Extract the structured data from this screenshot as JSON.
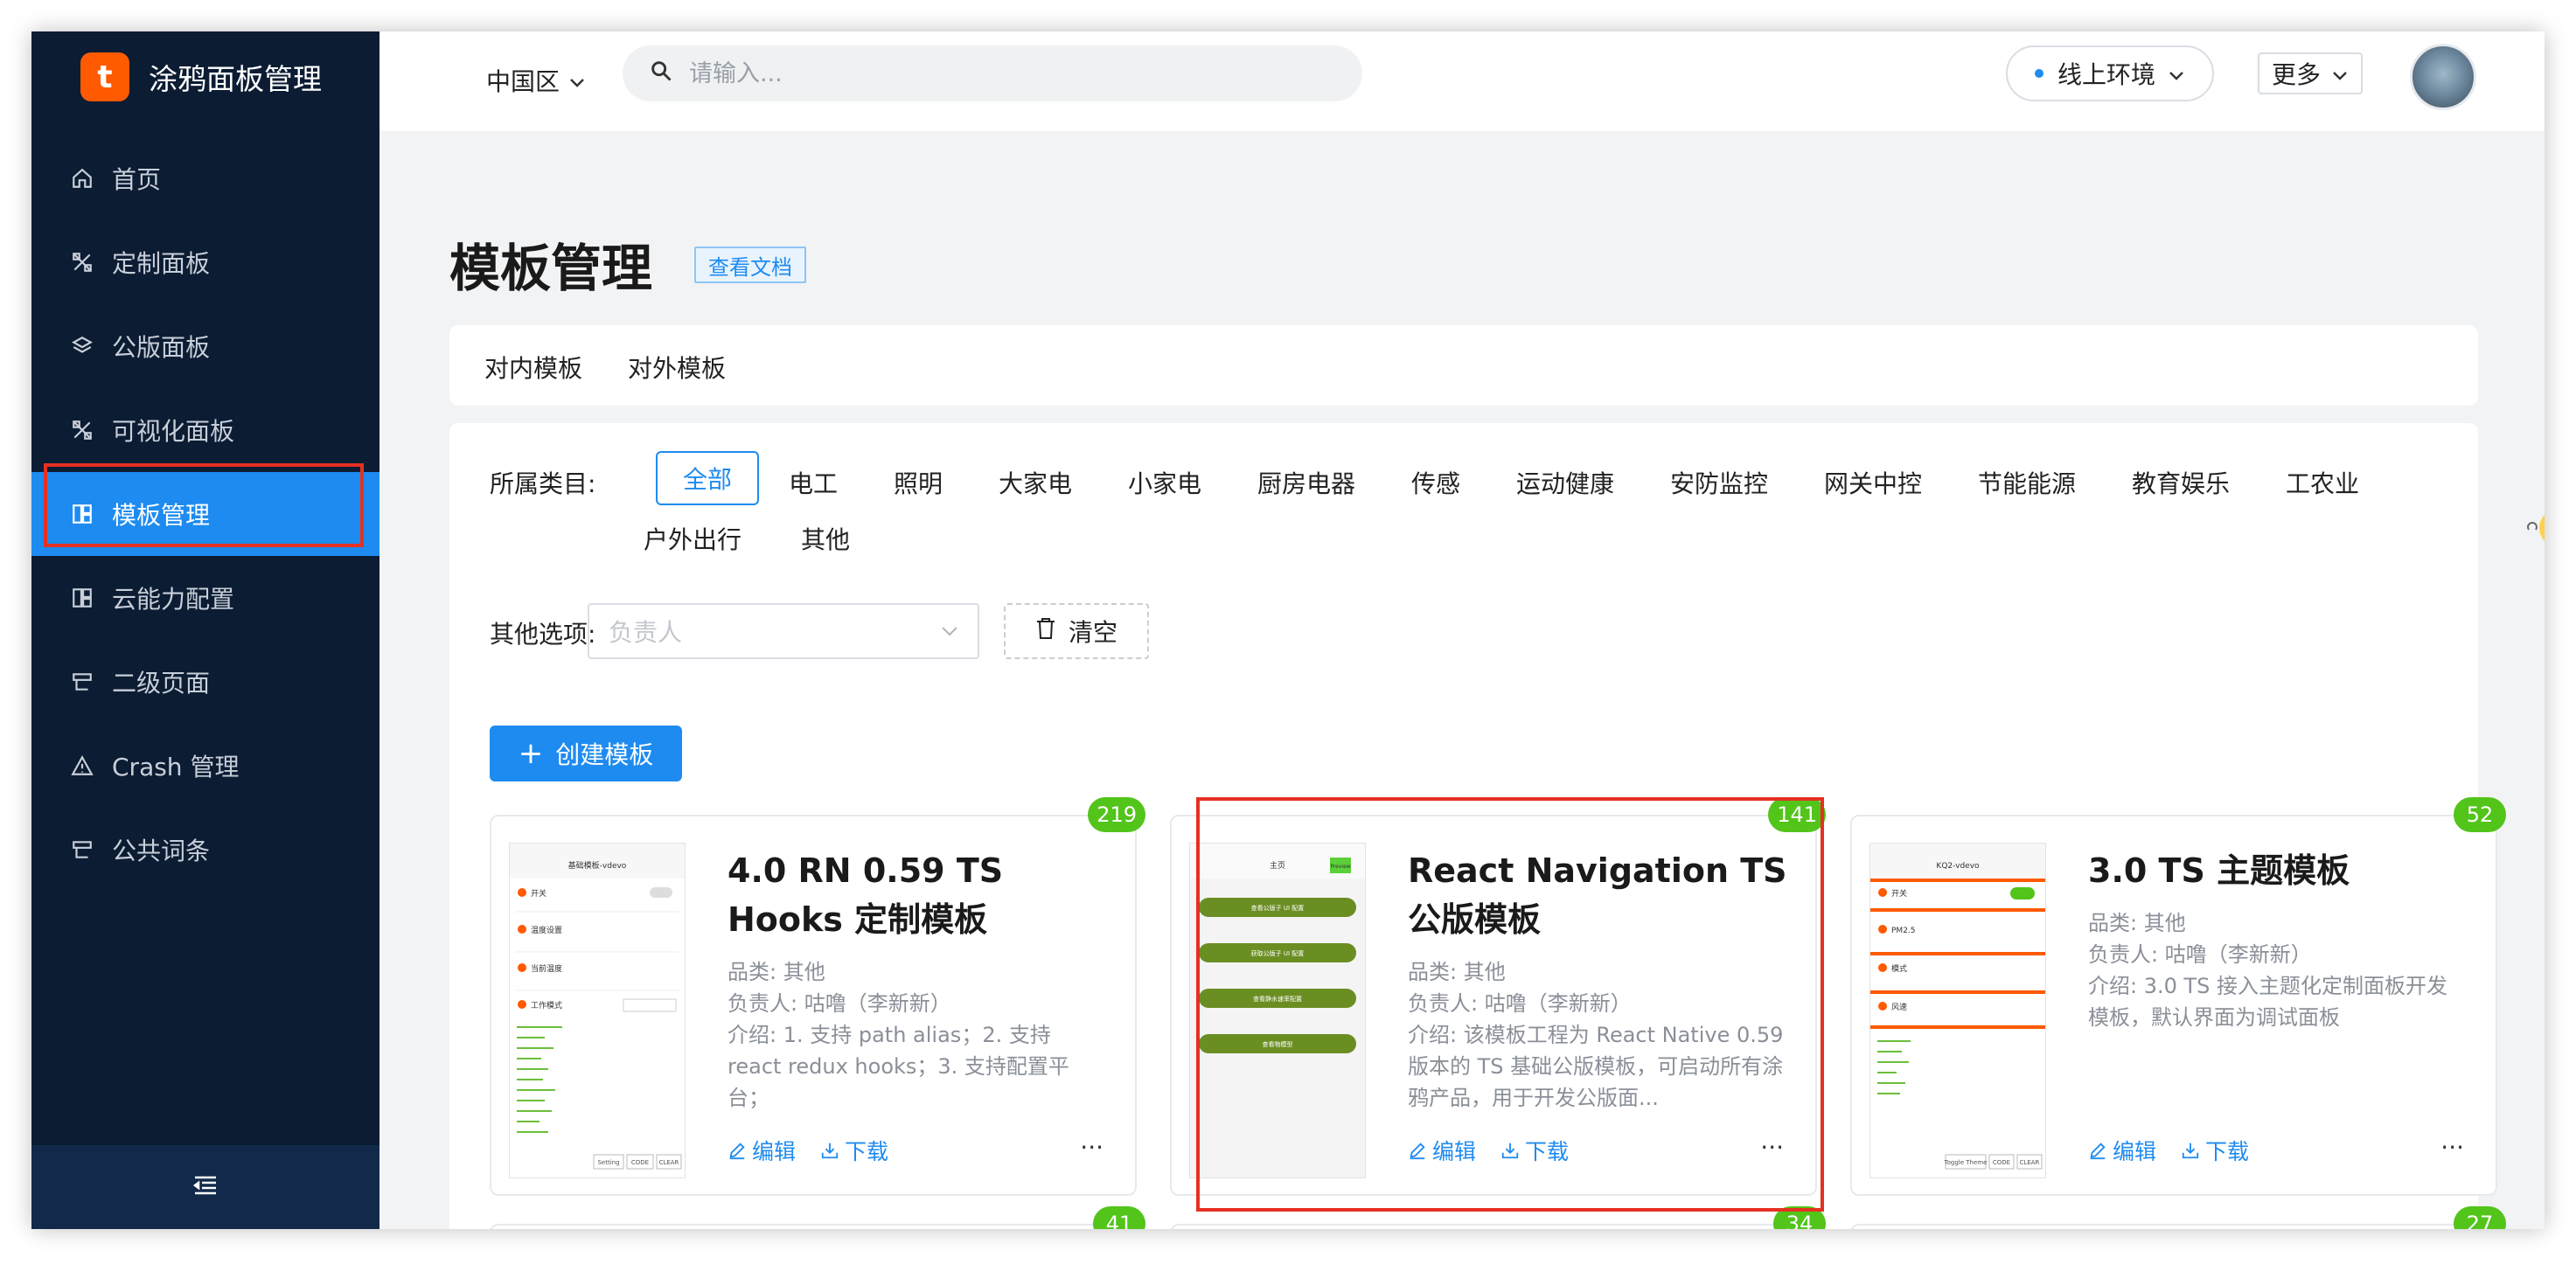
{
  "app": {
    "name": "涂鸦面板管理",
    "logo_letter": "t"
  },
  "sidebar": {
    "items": [
      {
        "label": "首页",
        "icon": "home-icon"
      },
      {
        "label": "定制面板",
        "icon": "custom-panel-icon"
      },
      {
        "label": "公版面板",
        "icon": "layers-icon"
      },
      {
        "label": "可视化面板",
        "icon": "visual-panel-icon"
      },
      {
        "label": "模板管理",
        "icon": "template-icon",
        "active": true
      },
      {
        "label": "云能力配置",
        "icon": "cloud-config-icon"
      },
      {
        "label": "二级页面",
        "icon": "subpage-icon"
      },
      {
        "label": "Crash 管理",
        "icon": "warning-icon"
      },
      {
        "label": "公共词条",
        "icon": "dictionary-icon"
      }
    ]
  },
  "header": {
    "region": "中国区",
    "search_placeholder": "请输入...",
    "env": "线上环境",
    "more": "更多"
  },
  "main": {
    "title": "模板管理",
    "doc_link": "查看文档",
    "tabs": [
      "对内模板",
      "对外模板"
    ],
    "category_label": "所属类目:",
    "categories": [
      "全部",
      "电工",
      "照明",
      "大家电",
      "小家电",
      "厨房电器",
      "传感",
      "运动健康",
      "安防监控",
      "网关中控",
      "节能能源",
      "教育娱乐",
      "工农业",
      "户外出行",
      "其他"
    ],
    "other_label": "其他选项:",
    "owner_placeholder": "负责人",
    "clear": "清空",
    "create": "创建模板"
  },
  "cards": [
    {
      "badge": "219",
      "title": "4.0 RN 0.59 TS Hooks 定制模板",
      "category": "品类: 其他",
      "owner": "负责人: 咕噜（李新新）",
      "intro": "介绍: 1. 支持 path alias；2. 支持 react redux hooks；3. 支持配置平台；",
      "edit": "编辑",
      "download": "下载"
    },
    {
      "badge": "141",
      "title": "React Navigation TS 公版模板",
      "category": "品类: 其他",
      "owner": "负责人: 咕噜（李新新）",
      "intro": "介绍: 该模板工程为 React Native 0.59 版本的 TS 基础公版模板，可启动所有涂鸦产品，用于开发公版面...",
      "edit": "编辑",
      "download": "下载"
    },
    {
      "badge": "52",
      "title": "3.0 TS 主题模板",
      "category": "品类: 其他",
      "owner": "负责人: 咕噜（李新新）",
      "intro": "介绍: 3.0 TS 接入主题化定制面板开发模板，默认界面为调试面板",
      "edit": "编辑",
      "download": "下载"
    }
  ],
  "next_badges": [
    "41",
    "34",
    "27"
  ],
  "thumbs": {
    "t1": {
      "title": "基础模板-vdevo",
      "rows": [
        "开关",
        "温度设置",
        "当前温度",
        "工作模式"
      ],
      "buttons": [
        "Setting",
        "CODE",
        "CLEAR"
      ]
    },
    "t2": {
      "title": "主页",
      "tag": "Preview",
      "buttons": [
        "查看公版子 UI 配置",
        "获取公版子 UI 配置",
        "查看静水速率配置",
        "查看物模型"
      ]
    },
    "t3": {
      "title": "KQ2-vdevo",
      "rows": [
        "开关",
        "PM2.5",
        "模式",
        "风速"
      ],
      "buttons": [
        "Toggle Theme",
        "CODE",
        "CLEAR"
      ]
    }
  },
  "colors": {
    "primary": "#1e8bf0",
    "sidebar": "#0b1c33",
    "badge": "#52c41a",
    "highlight": "#e53022",
    "logo": "#ff5a00"
  }
}
